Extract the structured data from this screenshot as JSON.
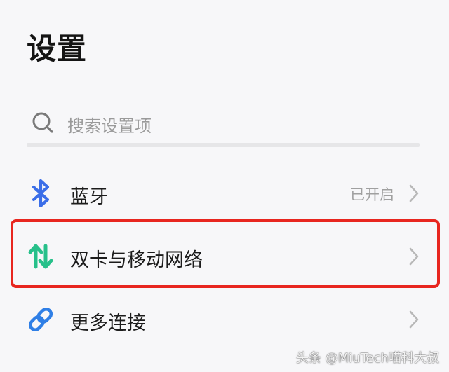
{
  "header": {
    "title": "设置"
  },
  "search": {
    "placeholder": "搜索设置项"
  },
  "rows": [
    {
      "label": "蓝牙",
      "status": "已开启",
      "icon": "bluetooth-icon"
    },
    {
      "label": "双卡与移动网络",
      "status": "",
      "icon": "mobile-network-icon"
    },
    {
      "label": "更多连接",
      "status": "",
      "icon": "link-icon"
    }
  ],
  "colors": {
    "bluetooth": "#3b6ee8",
    "network": "#27c08a",
    "link": "#2f7fe6",
    "highlight": "#e8261f"
  },
  "watermark": "头条 @MiuTech喵科大叔"
}
